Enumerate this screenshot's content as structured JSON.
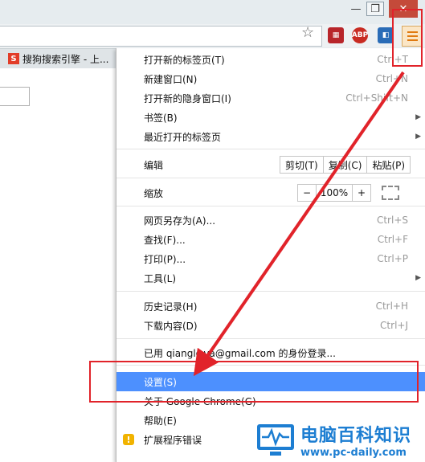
{
  "window": {
    "min_glyph": "—",
    "max_glyph": "❐",
    "close_glyph": "✕"
  },
  "toolbar": {
    "star_glyph": "☆",
    "extensions": [
      {
        "name": "film-extension-icon",
        "glyph": "▦"
      },
      {
        "name": "adblock-extension-icon",
        "glyph": "ABP"
      },
      {
        "name": "hd-extension-icon",
        "glyph": "◧"
      }
    ]
  },
  "tab": {
    "icon_letter": "S",
    "title": "搜狗搜索引擎 - 上..."
  },
  "menu": {
    "items": [
      {
        "label": "打开新的标签页(T)",
        "shortcut": "Ctrl+T"
      },
      {
        "label": "新建窗口(N)",
        "shortcut": "Ctrl+N"
      },
      {
        "label": "打开新的隐身窗口(I)",
        "shortcut": "Ctrl+Shift+N"
      },
      {
        "label": "书签(B)",
        "shortcut": ""
      },
      {
        "label": "最近打开的标签页",
        "shortcut": ""
      },
      {
        "label": "编辑",
        "shortcut": ""
      },
      {
        "label": "缩放",
        "shortcut": ""
      },
      {
        "label": "网页另存为(A)...",
        "shortcut": "Ctrl+S"
      },
      {
        "label": "查找(F)...",
        "shortcut": "Ctrl+F"
      },
      {
        "label": "打印(P)...",
        "shortcut": "Ctrl+P"
      },
      {
        "label": "工具(L)",
        "shortcut": ""
      },
      {
        "label": "历史记录(H)",
        "shortcut": "Ctrl+H"
      },
      {
        "label": "下载内容(D)",
        "shortcut": "Ctrl+J"
      },
      {
        "label": "已用 qianglo ya@gmail.com 的身份登录...",
        "shortcut": ""
      },
      {
        "label": "设置(S)",
        "shortcut": ""
      },
      {
        "label": "关于 Google Chrome(G)",
        "shortcut": ""
      },
      {
        "label": "帮助(E)",
        "shortcut": ""
      },
      {
        "label": "扩展程序错误",
        "shortcut": ""
      }
    ],
    "edit": {
      "cut": "剪切(T)",
      "copy": "复制(C)",
      "paste": "粘贴(P)"
    },
    "zoom": {
      "minus": "−",
      "level": "100%",
      "plus": "+"
    },
    "submenu_arrow": "▶",
    "warn_glyph": "!"
  },
  "watermark": {
    "title": "电脑百科知识",
    "url": "www.pc-daily.com"
  },
  "colors": {
    "highlight": "#4d90fe",
    "annotation_red": "#e1232a",
    "watermark_blue": "#1d7ed2"
  }
}
